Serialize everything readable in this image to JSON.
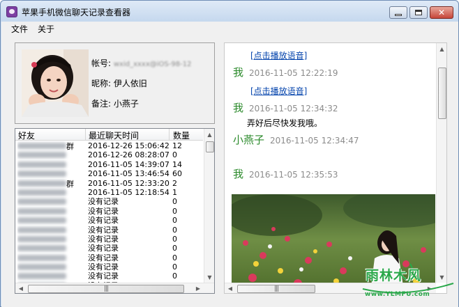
{
  "window": {
    "title": "苹果手机微信聊天记录查看器"
  },
  "menu": {
    "file": "文件",
    "about": "关于"
  },
  "profile": {
    "account_label": "帐号:",
    "account_value": "wxid_xxxx@iOS-98-12",
    "nickname_label": "昵称:",
    "nickname_value": "伊人依旧",
    "remark_label": "备注:",
    "remark_value": "小燕子"
  },
  "friends_table": {
    "headers": {
      "name": "好友",
      "time": "最近聊天时间",
      "count": "数量"
    },
    "rows": [
      {
        "name_suffix": "群",
        "time": "2016-12-26 15:06:42",
        "count": "12"
      },
      {
        "name_suffix": "",
        "time": "2016-12-26 08:28:07",
        "count": "0"
      },
      {
        "name_suffix": "",
        "time": "2016-11-05 14:39:07",
        "count": "14"
      },
      {
        "name_suffix": "",
        "time": "2016-11-05 13:46:54",
        "count": "60"
      },
      {
        "name_suffix": "群",
        "time": "2016-11-05 12:33:20",
        "count": "2"
      },
      {
        "name_suffix": "",
        "time": "2016-11-05 12:18:54",
        "count": "1"
      },
      {
        "name_suffix": "",
        "time": "没有记录",
        "count": "0"
      },
      {
        "name_suffix": "",
        "time": "没有记录",
        "count": "0"
      },
      {
        "name_suffix": "",
        "time": "没有记录",
        "count": "0"
      },
      {
        "name_suffix": "",
        "time": "没有记录",
        "count": "0"
      },
      {
        "name_suffix": "",
        "time": "没有记录",
        "count": "0"
      },
      {
        "name_suffix": "",
        "time": "没有记录",
        "count": "0"
      },
      {
        "name_suffix": "",
        "time": "没有记录",
        "count": "0"
      },
      {
        "name_suffix": "",
        "time": "没有记录",
        "count": "0"
      },
      {
        "name_suffix": "",
        "time": "没有记录",
        "count": "0"
      },
      {
        "name_suffix": "",
        "time": "没有记录",
        "count": "0"
      }
    ]
  },
  "chat": {
    "messages": [
      {
        "link": "[点击播放语音]",
        "sender": "我",
        "time": "2016-11-05 12:22:19",
        "text": ""
      },
      {
        "link": "[点击播放语音]",
        "sender": "我",
        "time": "2016-11-05 12:34:32",
        "text": "弄好后尽快发我哦。"
      },
      {
        "link": "",
        "sender": "小燕子",
        "time": "2016-11-05 12:34:47",
        "text": ""
      },
      {
        "link": "",
        "sender": "我",
        "time": "2016-11-05 12:35:53",
        "text": ""
      }
    ]
  },
  "scroll": {
    "up": "▲",
    "down": "▼",
    "left": "◀",
    "right": "▶",
    "grip": "|||"
  },
  "watermark": {
    "name": "雨林木风",
    "url": "www.YLMFU.com"
  },
  "colors": {
    "accent": "#2b8a2b",
    "link": "#0645ad",
    "timestamp": "#8c8c8c"
  }
}
